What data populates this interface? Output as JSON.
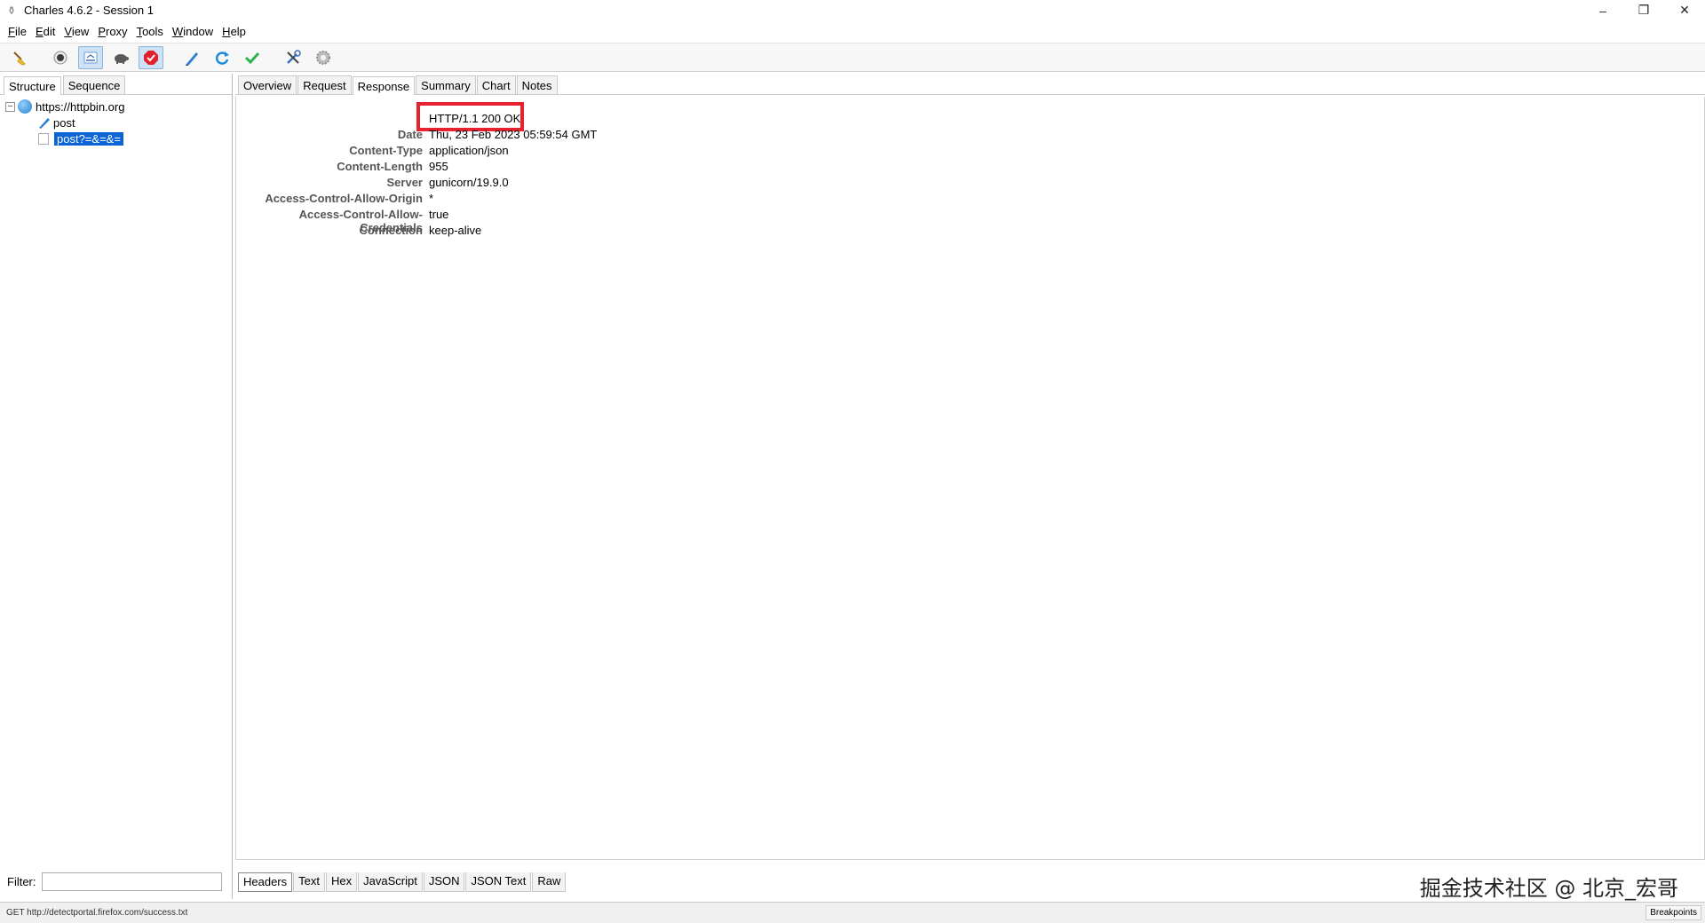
{
  "window": {
    "title": "Charles 4.6.2 - Session 1",
    "controls": [
      "–",
      "❐",
      "✕"
    ]
  },
  "menu": [
    {
      "label": "File",
      "mnemonic": "F",
      "rest": "ile"
    },
    {
      "label": "Edit",
      "mnemonic": "E",
      "rest": "dit"
    },
    {
      "label": "View",
      "mnemonic": "V",
      "rest": "iew"
    },
    {
      "label": "Proxy",
      "mnemonic": "P",
      "rest": "roxy"
    },
    {
      "label": "Tools",
      "mnemonic": "T",
      "rest": "ools"
    },
    {
      "label": "Window",
      "mnemonic": "W",
      "rest": "indow"
    },
    {
      "label": "Help",
      "mnemonic": "H",
      "rest": "elp"
    }
  ],
  "toolbar": {
    "icons": [
      "broom-icon",
      "record-icon",
      "throttle-icon",
      "turtle-icon",
      "breakpoint-icon",
      "compose-icon",
      "repeat-icon",
      "validate-icon",
      "tools-icon",
      "settings-icon"
    ],
    "colors": {
      "active_bg": "#cde2f5",
      "record_red": "#e0202a",
      "refresh_blue": "#1d8bd9",
      "check_green": "#2bb34b"
    }
  },
  "left": {
    "tabs": [
      {
        "label": "Structure",
        "active": true
      },
      {
        "label": "Sequence",
        "active": false
      }
    ],
    "tree": {
      "host": "https://httpbin.org",
      "toggle": "−",
      "children": [
        {
          "label": "post",
          "icon": "feather-icon",
          "selected": false
        },
        {
          "label": "post?=&=&=",
          "icon": "document-icon",
          "selected": true
        }
      ]
    },
    "filter": {
      "label": "Filter:",
      "value": ""
    }
  },
  "right": {
    "tabs": [
      {
        "label": "Overview",
        "active": false
      },
      {
        "label": "Request",
        "active": false
      },
      {
        "label": "Response",
        "active": true
      },
      {
        "label": "Summary",
        "active": false
      },
      {
        "label": "Chart",
        "active": false
      },
      {
        "label": "Notes",
        "active": false
      }
    ],
    "status_line": "HTTP/1.1 200 OK",
    "headers": [
      {
        "name": "Date",
        "value": "Thu, 23 Feb 2023 05:59:54 GMT"
      },
      {
        "name": "Content-Type",
        "value": "application/json"
      },
      {
        "name": "Content-Length",
        "value": "955"
      },
      {
        "name": "Server",
        "value": "gunicorn/19.9.0"
      },
      {
        "name": "Access-Control-Allow-Origin",
        "value": "*"
      },
      {
        "name": "Access-Control-Allow-Credentials",
        "value": "true"
      },
      {
        "name": "Connection",
        "value": "keep-alive"
      }
    ],
    "bottom_tabs": [
      {
        "label": "Headers",
        "active": true
      },
      {
        "label": "Text",
        "active": false
      },
      {
        "label": "Hex",
        "active": false
      },
      {
        "label": "JavaScript",
        "active": false
      },
      {
        "label": "JSON",
        "active": false
      },
      {
        "label": "JSON Text",
        "active": false
      },
      {
        "label": "Raw",
        "active": false
      }
    ],
    "highlight_color": "#e8212e"
  },
  "watermark": "掘金技术社区 @ 北京_宏哥",
  "statusbar": {
    "text": "GET http://detectportal.firefox.com/success.txt",
    "breakpoints": "Breakpoints"
  }
}
